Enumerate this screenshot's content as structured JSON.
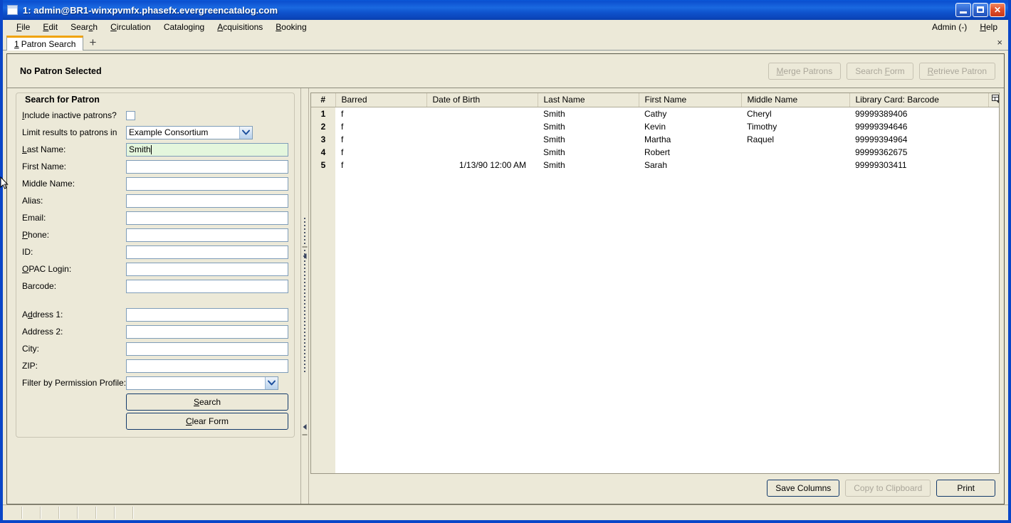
{
  "window": {
    "title": "1: admin@BR1-winxpvmfx.phasefx.evergreencatalog.com",
    "icon": "window-icon",
    "minimize": "minimize-icon",
    "maximize": "maximize-icon",
    "close": "close-icon"
  },
  "menubar": {
    "items": [
      {
        "label": "File",
        "accesskey": "F"
      },
      {
        "label": "Edit",
        "accesskey": "E"
      },
      {
        "label": "Search",
        "accesskey": "c"
      },
      {
        "label": "Circulation",
        "accesskey": "C"
      },
      {
        "label": "Cataloging",
        "accesskey": "g"
      },
      {
        "label": "Acquisitions",
        "accesskey": "A"
      },
      {
        "label": "Booking",
        "accesskey": "B"
      }
    ],
    "right": [
      {
        "label": "Admin (-)",
        "accesskey": ""
      },
      {
        "label": "Help",
        "accesskey": "H"
      }
    ]
  },
  "tabs": {
    "items": [
      {
        "number": "1",
        "label": "Patron Search"
      }
    ],
    "new_tab": "+",
    "close": "×"
  },
  "patron_bar": {
    "title": "No Patron Selected",
    "buttons": [
      {
        "label": "Merge Patrons",
        "disabled": true
      },
      {
        "label": "Search Form",
        "disabled": true
      },
      {
        "label": "Retrieve Patron",
        "disabled": true
      }
    ]
  },
  "search_form": {
    "legend": "Search for Patron",
    "include_inactive_label": "Include inactive patrons?",
    "include_inactive_checked": false,
    "limit_label": "Limit results to patrons in",
    "limit_value": "Example Consortium",
    "fields": [
      {
        "label": "Last Name:",
        "value": "Smith",
        "focused": true
      },
      {
        "label": "First Name:",
        "value": "",
        "focused": false
      },
      {
        "label": "Middle Name:",
        "value": "",
        "focused": false
      },
      {
        "label": "Alias:",
        "value": "",
        "focused": false
      },
      {
        "label": "Email:",
        "value": "",
        "focused": false
      },
      {
        "label": "Phone:",
        "value": "",
        "focused": false
      },
      {
        "label": "ID:",
        "value": "",
        "focused": false
      },
      {
        "label": "OPAC Login:",
        "value": "",
        "focused": false
      },
      {
        "label": "Barcode:",
        "value": "",
        "focused": false
      }
    ],
    "address_fields": [
      {
        "label": "Address 1:",
        "value": ""
      },
      {
        "label": "Address 2:",
        "value": ""
      },
      {
        "label": "City:",
        "value": ""
      },
      {
        "label": "ZIP:",
        "value": ""
      }
    ],
    "permission_label": "Filter by Permission Profile:",
    "permission_value": "",
    "search_button": "Search",
    "clear_button": "Clear Form"
  },
  "results": {
    "columns": [
      "#",
      "Barred",
      "Date of Birth",
      "Last Name",
      "First Name",
      "Middle Name",
      "Library Card: Barcode"
    ],
    "column_picker_icon": "column-picker-icon",
    "rows": [
      {
        "num": "1",
        "barred": "f",
        "dob": "",
        "last": "Smith",
        "first": "Cathy",
        "middle": "Cheryl",
        "barcode": "99999389406"
      },
      {
        "num": "2",
        "barred": "f",
        "dob": "",
        "last": "Smith",
        "first": "Kevin",
        "middle": "Timothy",
        "barcode": "99999394646"
      },
      {
        "num": "3",
        "barred": "f",
        "dob": "",
        "last": "Smith",
        "first": "Martha",
        "middle": "Raquel",
        "barcode": "99999394964"
      },
      {
        "num": "4",
        "barred": "f",
        "dob": "",
        "last": "Smith",
        "first": "Robert",
        "middle": "",
        "barcode": "99999362675"
      },
      {
        "num": "5",
        "barred": "f",
        "dob": "1/13/90 12:00 AM",
        "last": "Smith",
        "first": "Sarah",
        "middle": "",
        "barcode": "99999303411"
      }
    ],
    "footer_buttons": [
      {
        "label": "Save Columns",
        "disabled": false
      },
      {
        "label": "Copy to Clipboard",
        "disabled": true
      },
      {
        "label": "Print",
        "disabled": false
      }
    ]
  },
  "colors": {
    "titlebar_blue": "#0a46c8",
    "window_chrome": "#ece9d8",
    "tab_accent": "#f0a30a",
    "focused_field": "#e4f6dd",
    "field_border": "#7f9db9",
    "primary_button_border": "#133a6b"
  }
}
